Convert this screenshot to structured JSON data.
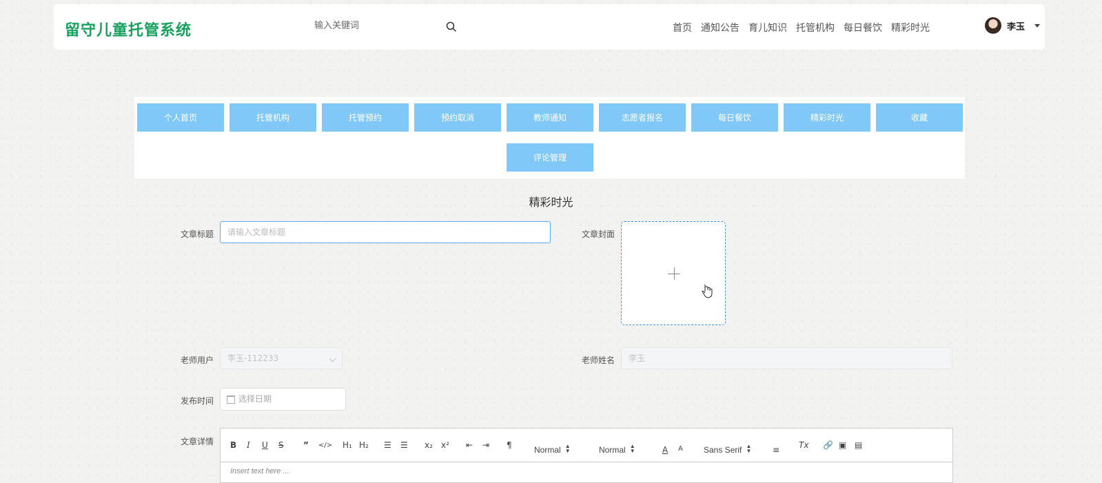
{
  "header": {
    "logo": "留守儿童托管系统",
    "search_placeholder": "输入关键词",
    "nav": [
      "首页",
      "通知公告",
      "育儿知识",
      "托管机构",
      "每日餐饮",
      "精彩时光"
    ],
    "user_name": "李玉"
  },
  "menu": {
    "items": [
      "个人首页",
      "托管机构",
      "托管预约",
      "预约取消",
      "教师通知",
      "志愿者报名",
      "每日餐饮",
      "精彩时光",
      "收藏",
      "评论管理"
    ],
    "button_color": "#80c8f8"
  },
  "form": {
    "section_title": "精彩时光",
    "title_label": "文章标题",
    "title_placeholder": "请输入文章标题",
    "cover_label": "文章封面",
    "teacher_user_label": "老师用户",
    "teacher_user_value": "李玉-112233",
    "teacher_name_label": "老师姓名",
    "teacher_name_value": "李玉",
    "publish_label": "发布时间",
    "date_placeholder": "选择日期",
    "detail_label": "文章详情"
  },
  "editor": {
    "header_select": "Normal",
    "size_select": "Normal",
    "font_select": "Sans Serif",
    "placeholder": "Insert text here ..."
  },
  "colors": {
    "brand": "#17a05e",
    "accent_border": "#5aa8f0"
  }
}
